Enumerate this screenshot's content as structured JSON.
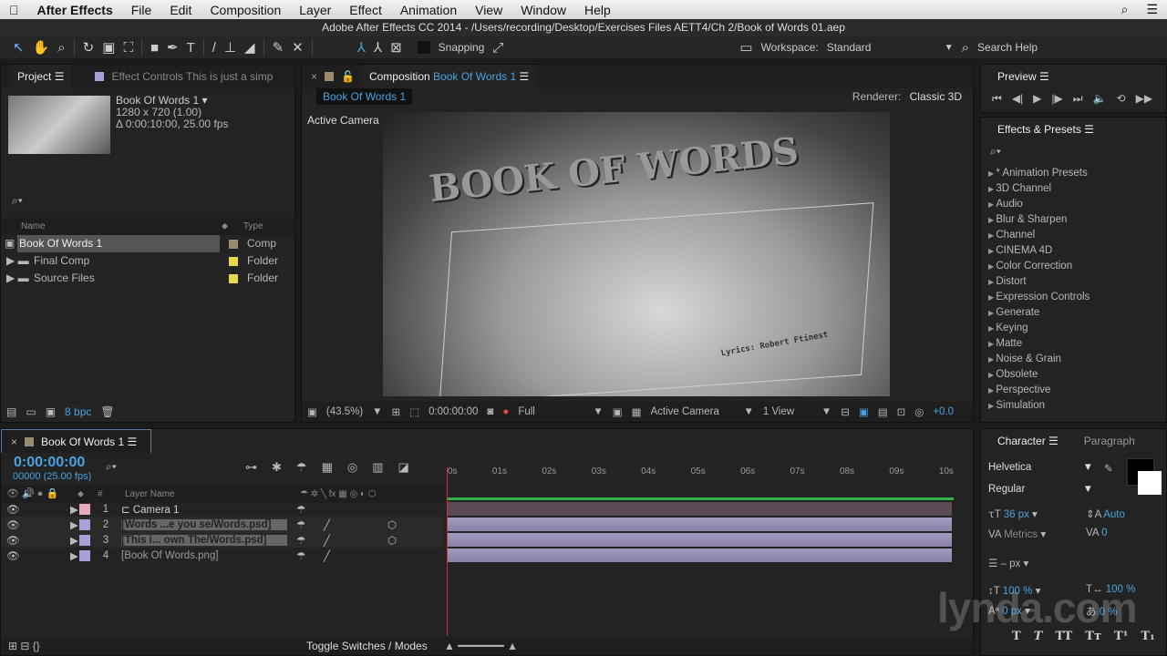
{
  "menubar": {
    "apple": "",
    "app": "After Effects",
    "items": [
      "File",
      "Edit",
      "Composition",
      "Layer",
      "Effect",
      "Animation",
      "View",
      "Window",
      "Help"
    ]
  },
  "titlebar": "Adobe After Effects CC 2014 - /Users/recording/Desktop/Exercises Files AETT4/Ch 2/Book of Words 01.aep",
  "toolbar": {
    "snapping": "Snapping",
    "workspace_label": "Workspace:",
    "workspace": "Standard",
    "search": "Search Help"
  },
  "project": {
    "tab": "Project",
    "effect_controls_tab": "Effect Controls This is just a simp",
    "comp_name": "Book Of Words 1 ▾",
    "comp_size": "1280 x 720 (1.00)",
    "comp_duration": "Δ 0:00:10:00, 25.00 fps",
    "search_icon": "⌕▾",
    "col_name": "Name",
    "col_type": "Type",
    "items": [
      {
        "name": "Book Of Words 1",
        "type": "Comp",
        "color": "#9a8a70"
      },
      {
        "name": "Final Comp",
        "type": "Folder",
        "color": "#e8d84a"
      },
      {
        "name": "Source Files",
        "type": "Folder",
        "color": "#e8d84a"
      }
    ],
    "bpc": "8 bpc"
  },
  "composition": {
    "tab_prefix": "Composition",
    "tab_name": "Book Of Words 1",
    "breadcrumb": "Book Of Words 1",
    "renderer_label": "Renderer:",
    "renderer": "Classic 3D",
    "view_label": "Active Camera",
    "image_title": "BOOK OF WORDS",
    "image_credit": "Lyrics: Robert Ftinest",
    "footer": {
      "zoom": "(43.5%)",
      "timecode": "0:00:00:00",
      "resolution": "Full",
      "camera": "Active Camera",
      "views": "1 View",
      "exposure": "+0.0"
    }
  },
  "preview": {
    "tab": "Preview"
  },
  "effects": {
    "tab": "Effects & Presets",
    "items": [
      "* Animation Presets",
      "3D Channel",
      "Audio",
      "Blur & Sharpen",
      "Channel",
      "CINEMA 4D",
      "Color Correction",
      "Distort",
      "Expression Controls",
      "Generate",
      "Keying",
      "Matte",
      "Noise & Grain",
      "Obsolete",
      "Perspective",
      "Simulation"
    ]
  },
  "timeline": {
    "tab": "Book Of Words 1",
    "timecode": "0:00:00:00",
    "frames": "00000 (25.00 fps)",
    "col_num": "#",
    "col_layer": "Layer Name",
    "ruler": [
      "0s",
      "01s",
      "02s",
      "03s",
      "04s",
      "05s",
      "06s",
      "07s",
      "08s",
      "09s",
      "10s"
    ],
    "layers": [
      {
        "num": "1",
        "name": "Camera 1",
        "color": "#e8a8c0"
      },
      {
        "num": "2",
        "name": "[Words ...e you se/Words.psd]",
        "color": "#a8a0d8"
      },
      {
        "num": "3",
        "name": "[This i... own The/Words.psd]",
        "color": "#a8a0d8"
      },
      {
        "num": "4",
        "name": "[Book Of Words.png]",
        "color": "#a8a0d8"
      }
    ],
    "toggle": "Toggle Switches / Modes"
  },
  "character": {
    "tab": "Character",
    "tab2": "Paragraph",
    "font": "Helvetica",
    "style": "Regular",
    "size": "36 px",
    "leading": "Auto",
    "kerning": "Metrics",
    "tracking": "0",
    "stroke": "– px",
    "vscale": "100 %",
    "hscale": "100 %",
    "baseline": "0 px",
    "tsume": "0 %"
  },
  "watermark": "lynda.com"
}
